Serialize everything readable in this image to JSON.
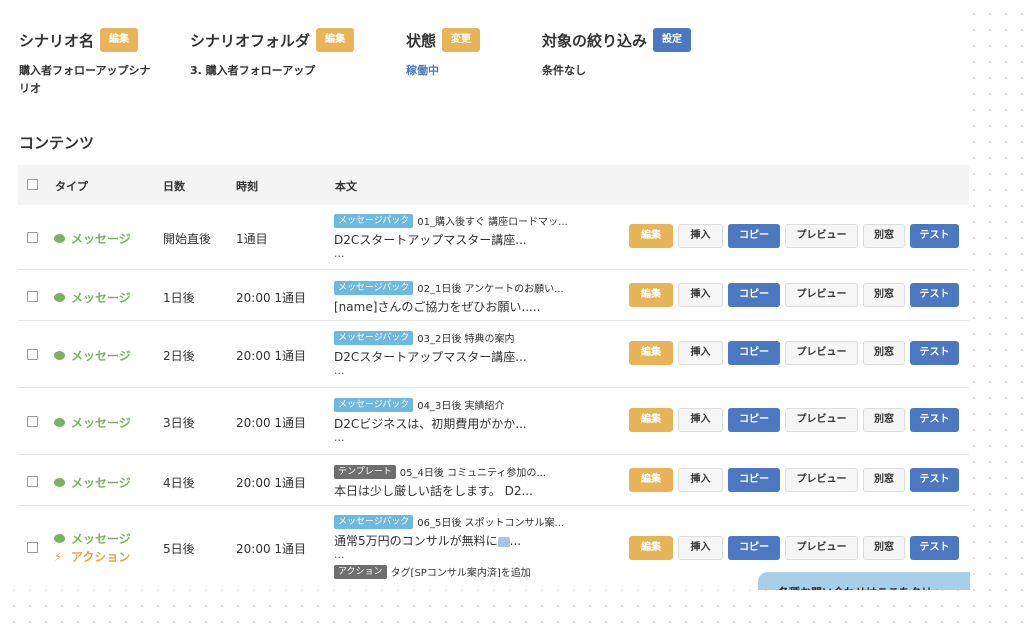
{
  "header": {
    "scenario_name": {
      "label": "シナリオ名",
      "button": "編集",
      "value": "購入者フォローアップシナリオ"
    },
    "scenario_folder": {
      "label": "シナリオフォルダ",
      "button": "編集",
      "value": "3. 購入者フォローアップ"
    },
    "status": {
      "label": "状態",
      "button": "変更",
      "value": "稼働中"
    },
    "filter": {
      "label": "対象の絞り込み",
      "button": "設定",
      "value": "条件なし"
    }
  },
  "contents": {
    "title": "コンテンツ",
    "columns": {
      "type": "タイプ",
      "days": "日数",
      "time": "時刻",
      "body": "本文"
    },
    "rows": [
      {
        "type": "メッセージ",
        "days": "開始直後",
        "time": "1通目",
        "tag": "メッセージパック",
        "tagline": "01_購入後すぐ 講座ロードマッ...",
        "text": "D2Cスタートアップマスター講座...",
        "dots": "..."
      },
      {
        "type": "メッセージ",
        "days": "1日後",
        "time": "20:00 1通目",
        "tag": "メッセージパック",
        "tagline": "02_1日後 アンケートのお願い...",
        "text": "[name]さんのご協力をぜひお願い.....",
        "dots": ""
      },
      {
        "type": "メッセージ",
        "days": "2日後",
        "time": "20:00 1通目",
        "tag": "メッセージパック",
        "tagline": "03_2日後 特典の案内",
        "text": "D2Cスタートアップマスター講座...",
        "dots": "..."
      },
      {
        "type": "メッセージ",
        "days": "3日後",
        "time": "20:00 1通目",
        "tag": "メッセージパック",
        "tagline": "04_3日後 実績紹介",
        "text": "D2Cビジネスは、初期費用がかか...",
        "dots": "..."
      },
      {
        "type": "メッセージ",
        "days": "4日後",
        "time": "20:00 1通目",
        "tag": "テンプレート",
        "tagline": "05_4日後 コミュニティ参加の...",
        "text": "本日は少し厳しい話をします。 D2...",
        "dots": ""
      },
      {
        "type": "メッセージ",
        "type2": "アクション",
        "days": "5日後",
        "time": "20:00 1通目",
        "tag": "メッセージパック",
        "tagline": "06_5日後 スポットコンサル案...",
        "text": "通常5万円のコンサルが無料に",
        "text_suffix": "...",
        "dots": "...",
        "action_tag": "アクション",
        "action_text": "タグ[SPコンサル案内済]を追加"
      }
    ],
    "buttons": {
      "edit": "編集",
      "insert": "挿入",
      "copy": "コピー",
      "preview": "プレビュー",
      "window": "別窓",
      "test": "テスト"
    }
  },
  "help_text": "各種お問い合わせはここをクリッ",
  "colors": {
    "accent_orange": "#e8b45a",
    "accent_blue": "#4c78c2",
    "message_green": "#7ab35f",
    "tag_blue": "#6fb8df"
  }
}
